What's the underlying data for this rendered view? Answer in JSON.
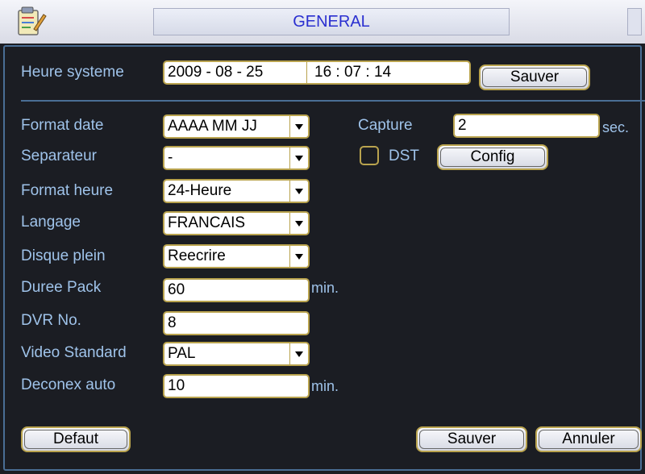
{
  "title": "GENERAL",
  "system_time": {
    "label": "Heure systeme",
    "date": "2009  - 08 - 25",
    "time": "16 : 07 : 14",
    "save_label": "Sauver"
  },
  "fields": {
    "date_format": {
      "label": "Format date",
      "value": "AAAA MM JJ"
    },
    "separator": {
      "label": "Separateur",
      "value": "-"
    },
    "time_format": {
      "label": "Format heure",
      "value": "24-Heure"
    },
    "language": {
      "label": "Langage",
      "value": "FRANCAIS"
    },
    "disk_full": {
      "label": "Disque plein",
      "value": "Reecrire"
    },
    "pack_duration": {
      "label": "Duree Pack",
      "value": "60",
      "unit": "min."
    },
    "dvr_no": {
      "label": "DVR No.",
      "value": "8"
    },
    "video_standard": {
      "label": "Video Standard",
      "value": "PAL"
    },
    "auto_logout": {
      "label": "Deconex auto",
      "value": "10",
      "unit": "min."
    },
    "capture": {
      "label": "Capture",
      "value": "2",
      "unit": "sec."
    },
    "dst": {
      "label": "DST",
      "checked": false,
      "config_label": "Config"
    }
  },
  "footer": {
    "default_label": "Defaut",
    "save_label": "Sauver",
    "cancel_label": "Annuler"
  },
  "icons": {
    "app": "settings-sheet-icon",
    "dropdown": "chevron-down-icon"
  },
  "colors": {
    "label": "#9fc3ea",
    "title": "#2a2fd0",
    "field_border": "#b9a34e",
    "frame": "#4a6e95",
    "background": "#1b1d23"
  }
}
